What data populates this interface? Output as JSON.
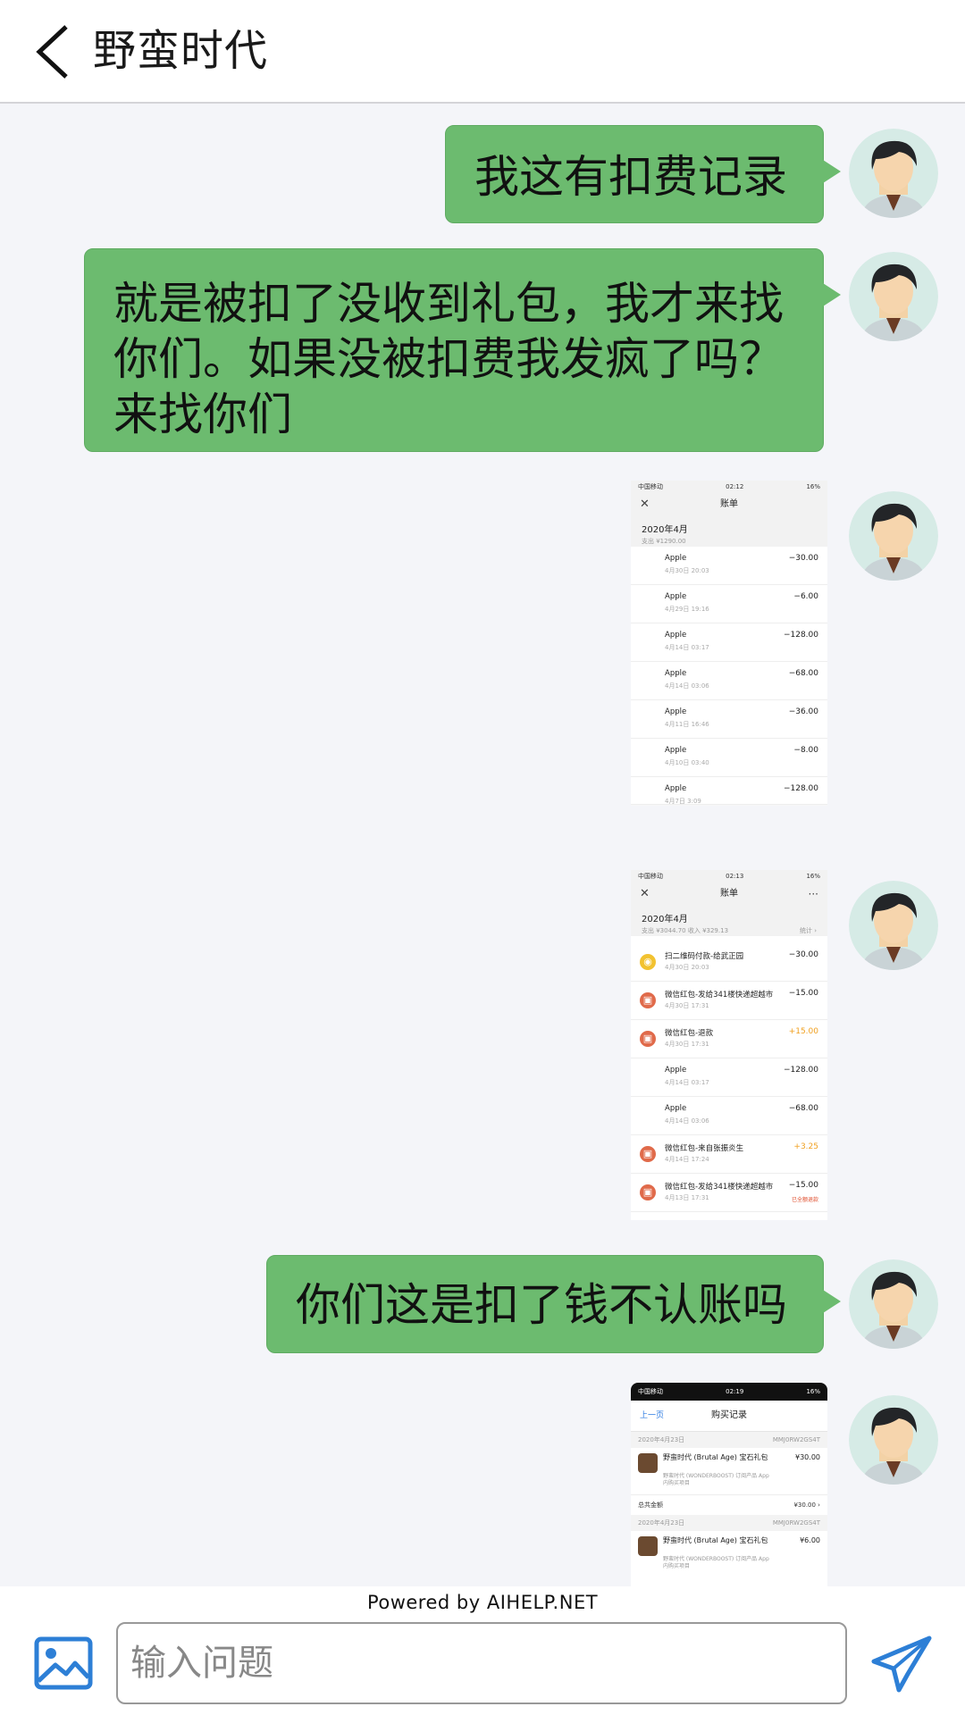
{
  "header": {
    "title": "野蛮时代",
    "back_icon": "chevron-left-icon"
  },
  "messages": [
    {
      "type": "text",
      "text": "我这有扣费记录"
    },
    {
      "type": "text",
      "text": "就是被扣了没收到礼包，我才来找你们。如果没被扣费我发疯了吗？来找你们"
    },
    {
      "type": "image",
      "status_left": "中国移动",
      "status_time": "02:12",
      "status_right": "16%",
      "nav_title": "账单",
      "month": "2020年4月",
      "summary": "支出 ¥1290.00",
      "rows": [
        {
          "name": "Apple",
          "date": "4月30日 20:03",
          "amount": "−30.00"
        },
        {
          "name": "Apple",
          "date": "4月29日 19:16",
          "amount": "−6.00"
        },
        {
          "name": "Apple",
          "date": "4月14日 03:17",
          "amount": "−128.00"
        },
        {
          "name": "Apple",
          "date": "4月14日 03:06",
          "amount": "−68.00"
        },
        {
          "name": "Apple",
          "date": "4月11日 16:46",
          "amount": "−36.00"
        },
        {
          "name": "Apple",
          "date": "4月10日 03:40",
          "amount": "−8.00"
        },
        {
          "name": "Apple",
          "date": "4月7日 3:09",
          "amount": "−128.00"
        }
      ],
      "pager_prev": "‹",
      "pager_next": "›"
    },
    {
      "type": "image",
      "status_left": "中国移动",
      "status_time": "02:13",
      "status_right": "16%",
      "nav_title": "账单",
      "nav_more": "···",
      "month": "2020年4月",
      "summary": "支出 ¥3044.70 收入 ¥329.13",
      "summary_right": "统计 ›",
      "rows": [
        {
          "icon": "wallet",
          "name": "扫二维码付款-给武正园",
          "date": "4月30日 20:03",
          "amount": "−30.00"
        },
        {
          "icon": "redpacket",
          "name": "微信红包-发给341楼快递超越市",
          "date": "4月30日 17:31",
          "amount": "−15.00"
        },
        {
          "icon": "redpacket",
          "name": "微信红包-退款",
          "date": "4月30日 17:31",
          "amount": "+15.00",
          "positive": true
        },
        {
          "icon": "apple",
          "name": "Apple",
          "date": "4月14日 03:17",
          "amount": "−128.00"
        },
        {
          "icon": "apple",
          "name": "Apple",
          "date": "4月14日 03:06",
          "amount": "−68.00"
        },
        {
          "icon": "redpacket",
          "name": "微信红包-来自张振炎生",
          "date": "4月14日 17:24",
          "amount": "+3.25",
          "positive": true
        },
        {
          "icon": "redpacket",
          "name": "微信红包-发给341楼快递超越市",
          "date": "4月13日 17:31",
          "amount": "−15.00",
          "tag": "已全额退款"
        }
      ]
    },
    {
      "type": "text",
      "text": "你们这是扣了钱不认账吗"
    },
    {
      "type": "image",
      "status_left": "中国移动",
      "status_time": "02:19",
      "status_right": "16%",
      "nav_back": "上一页",
      "nav_title": "购买记录",
      "sections": [
        {
          "date": "2020年4月23日",
          "order": "MMJ0RW2GS4T",
          "item_name": "野蛮时代 (Brutal Age) 宝石礼包",
          "item_sub": "野蛮时代 (WONDERBOOST) 订阅产品 App 内购买项目",
          "price": "¥30.00",
          "total_label": "总共金额",
          "total": "¥30.00 ›"
        },
        {
          "date": "2020年4月23日",
          "order": "MMJ0RW2GS4T",
          "item_name": "野蛮时代 (Brutal Age) 宝石礼包",
          "item_sub": "野蛮时代 (WONDERBOOST) 订阅产品 App 内购买项目",
          "price": "¥6.00"
        }
      ]
    }
  ],
  "footer": {
    "powered": "Powered by AIHELP.NET",
    "input_placeholder": "输入问题",
    "image_icon": "image-icon",
    "send_icon": "send-icon"
  },
  "colors": {
    "bubble": "#6cbb6f",
    "background": "#f4f5f9",
    "accent": "#2a7ae2"
  }
}
